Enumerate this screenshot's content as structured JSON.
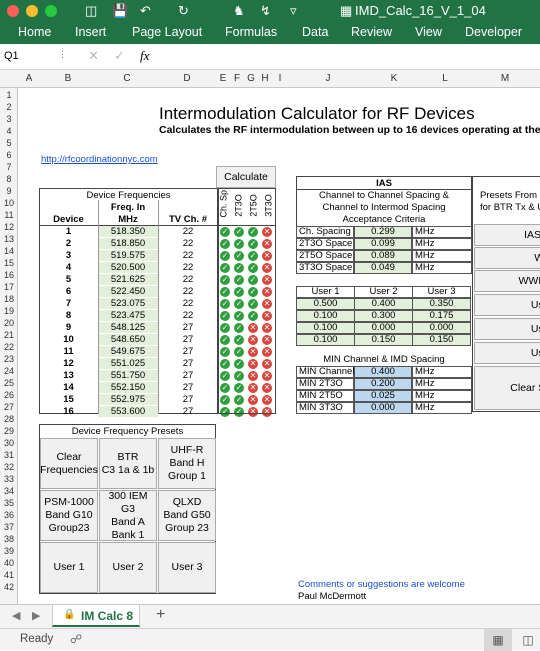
{
  "window": {
    "filename": "IMD_Calc_16_V_1_04"
  },
  "ribbon": {
    "tabs": [
      "Home",
      "Insert",
      "Page Layout",
      "Formulas",
      "Data",
      "Review",
      "View",
      "Developer"
    ]
  },
  "formula_bar": {
    "name_box": "Q1",
    "fx": "fx"
  },
  "columns": [
    "A",
    "B",
    "C",
    "D",
    "E",
    "F",
    "G",
    "H",
    "I",
    "J",
    "K",
    "L",
    "M"
  ],
  "rows": [
    "1",
    "2",
    "3",
    "4",
    "5",
    "6",
    "7",
    "8",
    "9",
    "10",
    "11",
    "12",
    "13",
    "14",
    "15",
    "16",
    "17",
    "18",
    "19",
    "20",
    "21",
    "22",
    "23",
    "24",
    "25",
    "26",
    "27",
    "28",
    "29",
    "30",
    "31",
    "32",
    "33",
    "34",
    "35",
    "36",
    "37",
    "38",
    "39",
    "40",
    "41",
    "42"
  ],
  "sheet": {
    "title": "Intermodulation Calculator for RF Devices",
    "subtitle": "Calculates the RF intermodulation between up to 16 devices operating at the s",
    "link": "http://rfcoordinationnyc.com",
    "calculate_label": "Calculate",
    "device_freq_header": "Device Frequencies",
    "col_device": "Device",
    "col_freq_in": "Freq. In",
    "col_mhz": "MHz",
    "col_tv": "TV Ch. #",
    "check_headers": [
      "Ch. Sp",
      "2T3O",
      "2T5O",
      "3T3O"
    ],
    "devices": [
      {
        "n": "1",
        "f": "518.350",
        "tv": "22",
        "s": [
          "ok",
          "ok",
          "ok",
          "no"
        ]
      },
      {
        "n": "2",
        "f": "518.850",
        "tv": "22",
        "s": [
          "ok",
          "ok",
          "ok",
          "no"
        ]
      },
      {
        "n": "3",
        "f": "519.575",
        "tv": "22",
        "s": [
          "ok",
          "ok",
          "ok",
          "no"
        ]
      },
      {
        "n": "4",
        "f": "520.500",
        "tv": "22",
        "s": [
          "ok",
          "ok",
          "ok",
          "no"
        ]
      },
      {
        "n": "5",
        "f": "521.625",
        "tv": "22",
        "s": [
          "ok",
          "ok",
          "ok",
          "no"
        ]
      },
      {
        "n": "6",
        "f": "522.450",
        "tv": "22",
        "s": [
          "ok",
          "ok",
          "ok",
          "no"
        ]
      },
      {
        "n": "7",
        "f": "523.075",
        "tv": "22",
        "s": [
          "ok",
          "ok",
          "ok",
          "no"
        ]
      },
      {
        "n": "8",
        "f": "523.475",
        "tv": "22",
        "s": [
          "ok",
          "ok",
          "ok",
          "no"
        ]
      },
      {
        "n": "9",
        "f": "548.125",
        "tv": "27",
        "s": [
          "ok",
          "ok",
          "no",
          "no"
        ]
      },
      {
        "n": "10",
        "f": "548.650",
        "tv": "27",
        "s": [
          "ok",
          "ok",
          "no",
          "no"
        ]
      },
      {
        "n": "11",
        "f": "549.675",
        "tv": "27",
        "s": [
          "ok",
          "ok",
          "no",
          "no"
        ]
      },
      {
        "n": "12",
        "f": "551.025",
        "tv": "27",
        "s": [
          "ok",
          "ok",
          "no",
          "no"
        ]
      },
      {
        "n": "13",
        "f": "551.750",
        "tv": "27",
        "s": [
          "ok",
          "ok",
          "no",
          "no"
        ]
      },
      {
        "n": "14",
        "f": "552.150",
        "tv": "27",
        "s": [
          "ok",
          "ok",
          "no",
          "no"
        ]
      },
      {
        "n": "15",
        "f": "552.975",
        "tv": "27",
        "s": [
          "ok",
          "ok",
          "no",
          "no"
        ]
      },
      {
        "n": "16",
        "f": "553.600",
        "tv": "27",
        "s": [
          "ok",
          "ok",
          "no",
          "no"
        ]
      }
    ],
    "ias": {
      "header": "IAS",
      "desc": [
        "Channel to Channel Spacing &",
        "Channel to Intermod Spacing",
        "Acceptance Criteria"
      ],
      "rows": [
        {
          "label": "Ch. Spacing",
          "value": "0.299",
          "unit": "MHz"
        },
        {
          "label": "2T3O Space",
          "value": "0.099",
          "unit": "MHz"
        },
        {
          "label": "2T5O Space",
          "value": "0.089",
          "unit": "MHz"
        },
        {
          "label": "3T3O Space",
          "value": "0.049",
          "unit": "MHz"
        }
      ]
    },
    "users": {
      "headers": [
        "User 1",
        "User 2",
        "User 3"
      ],
      "rows": [
        [
          "0.500",
          "0.400",
          "0.350"
        ],
        [
          "0.100",
          "0.300",
          "0.175"
        ],
        [
          "0.100",
          "0.000",
          "0.000"
        ],
        [
          "0.100",
          "0.150",
          "0.150"
        ]
      ]
    },
    "min_spacing": {
      "header": "MIN Channel & IMD Spacing",
      "rows": [
        {
          "label": "MIN Channel",
          "value": "0.400",
          "unit": "MHz"
        },
        {
          "label": "MIN 2T3O",
          "value": "0.200",
          "unit": "MHz"
        },
        {
          "label": "MIN 2T5O",
          "value": "0.025",
          "unit": "MHz"
        },
        {
          "label": "MIN 3T3O",
          "value": "0.000",
          "unit": "MHz"
        }
      ]
    },
    "presets_right": {
      "title_lines": [
        "Presets From I",
        "for BTR Tx & U"
      ],
      "buttons": [
        "IAS",
        "WWI",
        "WWB m",
        "User",
        "User",
        "User",
        "Clear Spa"
      ]
    },
    "device_presets": {
      "header": "Device Frequency Presets",
      "buttons": [
        [
          "Clear",
          "Frequencies"
        ],
        [
          "BTR",
          "C3 1a & 1b"
        ],
        [
          "UHF-R",
          "Band H",
          "Group 1"
        ],
        [
          "PSM-1000",
          "Band G10",
          "Group23"
        ],
        [
          "300 IEM G3",
          "Band A",
          "Bank 1"
        ],
        [
          "QLXD",
          "Band G50",
          "Group 23"
        ],
        [
          "User 1"
        ],
        [
          "User 2"
        ],
        [
          "User 3"
        ]
      ]
    },
    "comments": "Comments or suggestions are welcome",
    "author": "Paul McDermott"
  },
  "sheet_tabs": {
    "active": "IM Calc 8",
    "add": "+"
  },
  "status": {
    "ready": "Ready"
  },
  "colors": {
    "excel_green": "#217346",
    "ok": "#2e9e3e",
    "fail": "#d8463b",
    "user_green": "#e2efda",
    "min_blue": "#bdd7ee"
  }
}
